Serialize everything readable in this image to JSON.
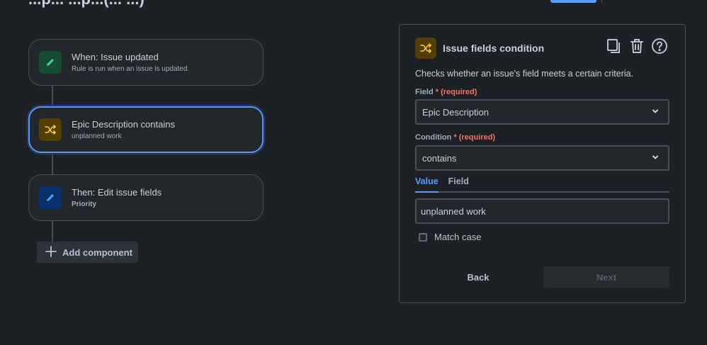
{
  "top": {
    "title": "...p... ...p...(... ...)"
  },
  "flow": {
    "trigger": {
      "title": "When: Issue updated",
      "subtitle": "Rule is run when an issue is updated."
    },
    "condition": {
      "title": "Epic Description contains",
      "subtitle": "unplanned work"
    },
    "action": {
      "title": "Then: Edit issue fields",
      "subtitle": "Priority"
    },
    "add_component_label": "Add component"
  },
  "panel": {
    "title": "Issue fields condition",
    "description": "Checks whether an issue's field meets a certain criteria.",
    "field_label": "Field",
    "required_text": "(required)",
    "field_value": "Epic Description",
    "condition_label": "Condition",
    "condition_value": "contains",
    "tabs": [
      {
        "label": "Value",
        "active": true
      },
      {
        "label": "Field",
        "active": false
      }
    ],
    "value_input": "unplanned work",
    "match_case_label": "Match case",
    "match_case_checked": false,
    "back_label": "Back",
    "next_label": "Next"
  },
  "colors": {
    "accent": "#579dff",
    "required": "#f87168",
    "trigger_icon": "#4bce97",
    "condition_icon": "#f5cd47",
    "action_icon": "#579dff"
  }
}
